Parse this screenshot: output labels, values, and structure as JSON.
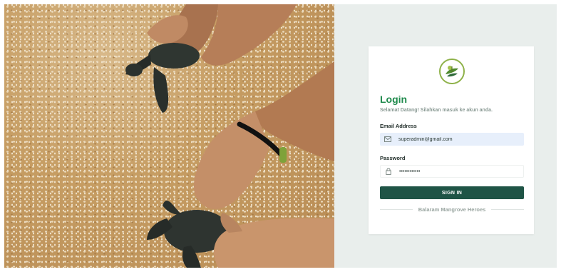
{
  "login": {
    "title": "Login",
    "subtitle": "Selamat Datang! Silahkan masuk ke akun anda.",
    "email_label": "Email Address",
    "email_value": "superadmin@gmail.com",
    "password_label": "Password",
    "password_value": "••••••••••••",
    "submit_label": "SIGN IN",
    "footer_text": "Balaram Mangrove Heroes"
  },
  "icons": {
    "email": "envelope-icon",
    "password": "lock-icon",
    "logo": "mangrove-logo"
  },
  "colors": {
    "accent_green": "#1f8a4c",
    "button_bg": "#1f5446",
    "panel_bg": "#e9eeec",
    "email_field_bg": "#e7effb"
  }
}
